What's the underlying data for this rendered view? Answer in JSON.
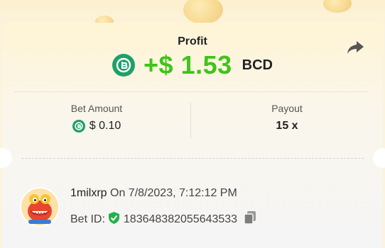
{
  "profit": {
    "label": "Profit",
    "value": "+$ 1.53",
    "currency": "BCD"
  },
  "bet_amount": {
    "label": "Bet Amount",
    "value": "$ 0.10"
  },
  "payout": {
    "label": "Payout",
    "value": "15 x"
  },
  "user": {
    "name": "1milxrp",
    "timestamp": "On 7/8/2023, 7:12:12 PM"
  },
  "bet": {
    "id_label": "Bet ID:",
    "id_value": "183648382055643533"
  },
  "icons": {
    "coin": "bcd-coin-icon",
    "share": "share-icon",
    "verified": "shield-check-icon",
    "copy": "copy-icon"
  },
  "colors": {
    "profit_green": "#3fc41a",
    "coin_green": "#1fa06a"
  }
}
